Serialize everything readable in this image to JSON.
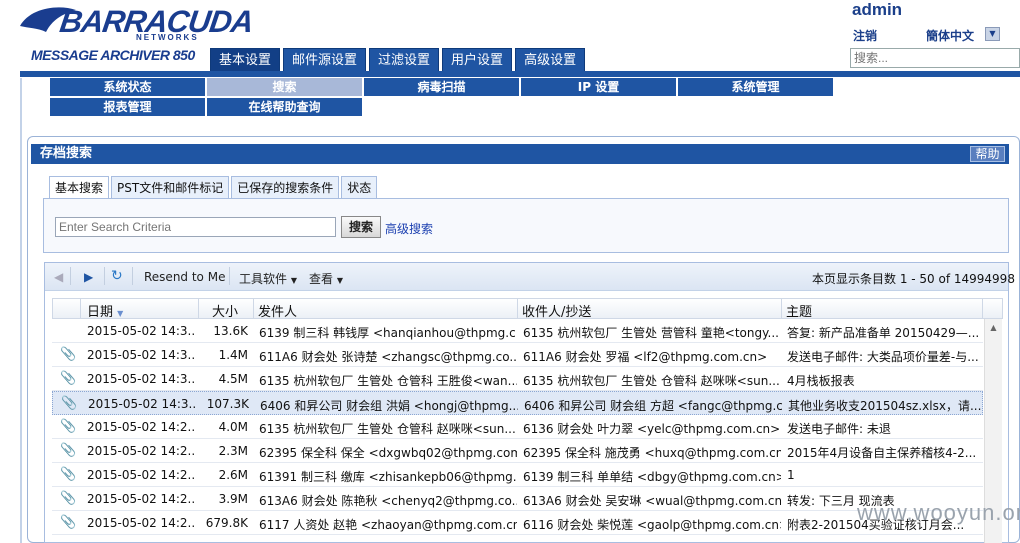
{
  "brand": {
    "name": "BARRACUDA",
    "sub": "NETWORKS",
    "product": "MESSAGE ARCHIVER 850"
  },
  "user": {
    "name": "admin",
    "logout": "注销",
    "language": "簡体中文",
    "search_placeholder": "搜索..."
  },
  "top_tabs": [
    {
      "label": "基本设置"
    },
    {
      "label": "邮件源设置"
    },
    {
      "label": "过滤设置"
    },
    {
      "label": "用户设置"
    },
    {
      "label": "高级设置"
    }
  ],
  "sub_nav": [
    {
      "label": "系统状态"
    },
    {
      "label": "搜索"
    },
    {
      "label": "病毒扫描"
    },
    {
      "label": "IP 设置"
    },
    {
      "label": "系统管理"
    },
    {
      "label": "报表管理"
    },
    {
      "label": "在线帮助查询"
    }
  ],
  "panel": {
    "title": "存档搜索",
    "help": "帮助"
  },
  "tabs": [
    {
      "label": "基本搜索"
    },
    {
      "label": "PST文件和邮件标记"
    },
    {
      "label": "已保存的搜索条件"
    },
    {
      "label": "状态"
    }
  ],
  "search": {
    "placeholder": "Enter Search Criteria",
    "button": "搜索",
    "advanced": "高级搜索"
  },
  "toolbar": {
    "resend": "Resend to Me",
    "tools": "工具软件",
    "view": "查看",
    "page_info": "本页显示条目数 1 - 50 of 14994998"
  },
  "columns": {
    "date": "日期",
    "size": "大小",
    "from": "发件人",
    "to": "收件人/抄送",
    "subject": "主题"
  },
  "rows": [
    {
      "date": "2015-05-02 14:3...",
      "size": "13.6K",
      "from": "6139 制三科 韩钱厚 <hanqianhou@thpmg.c...",
      "to": "6135 杭州软包厂 生管处 营管科 童艳<tongy...",
      "subject": "答复: 新产品准备单 20150429—...",
      "attach": false
    },
    {
      "date": "2015-05-02 14:3...",
      "size": "1.4M",
      "from": "611A6 财会处 张诗楚 <zhangsc@thpmg.co...",
      "to": "611A6 财会处 罗福 <lf2@thpmg.com.cn>",
      "subject": "发送电子邮件: 大类品项价量差-与...",
      "attach": true
    },
    {
      "date": "2015-05-02 14:3...",
      "size": "4.5M",
      "from": "6135 杭州软包厂 生管处 仓管科 王胜俊<wan...",
      "to": "6135 杭州软包厂 生管处 仓管科 赵咪咪<sun...",
      "subject": "4月栈板报表",
      "attach": true
    },
    {
      "date": "2015-05-02 14:3...",
      "size": "107.3K",
      "from": "6406 和昇公司 财会组 洪娟 <hongj@thpmg...",
      "to": "6406 和昇公司 财会组 方超 <fangc@thpmg.c...",
      "subject": "其他业务收支201504sz.xlsx，请...",
      "attach": true,
      "selected": true
    },
    {
      "date": "2015-05-02 14:2...",
      "size": "4.0M",
      "from": "6135 杭州软包厂 生管处 仓管科 赵咪咪<sun...",
      "to": "6136 财会处 叶力翠 <yelc@thpmg.com.cn>",
      "subject": "发送电子邮件: 未退",
      "attach": true
    },
    {
      "date": "2015-05-02 14:2...",
      "size": "2.3M",
      "from": "62395 保全科 保全 <dxgwbq02@thpmg.com...",
      "to": "62395 保全科 施茂勇 <huxq@thpmg.com.cn>",
      "subject": "2015年4月设备自主保养稽核4-2...",
      "attach": true
    },
    {
      "date": "2015-05-02 14:2...",
      "size": "2.6M",
      "from": "61391 制三科 缴库 <zhisankepb06@thpmg....",
      "to": "6139 制三科 单单结 <dbgy@thpmg.com.cn>",
      "subject": "1",
      "attach": true
    },
    {
      "date": "2015-05-02 14:2...",
      "size": "3.9M",
      "from": "613A6 财会处 陈艳秋 <chenyq2@thpmg.co...",
      "to": "613A6 财会处 吴安琳 <wual@thpmg.com.cn>",
      "subject": "转发: 下三月 现流表",
      "attach": true
    },
    {
      "date": "2015-05-02 14:2...",
      "size": "679.8K",
      "from": "6117 人资处 赵艳 <zhaoyan@thpmg.com.cn>",
      "to": "6116 财会处 柴悦莲 <gaolp@thpmg.com.cn>",
      "subject": "附表2-201504买验证核订月会...",
      "attach": true
    }
  ],
  "watermark": "www.wooyun.org"
}
